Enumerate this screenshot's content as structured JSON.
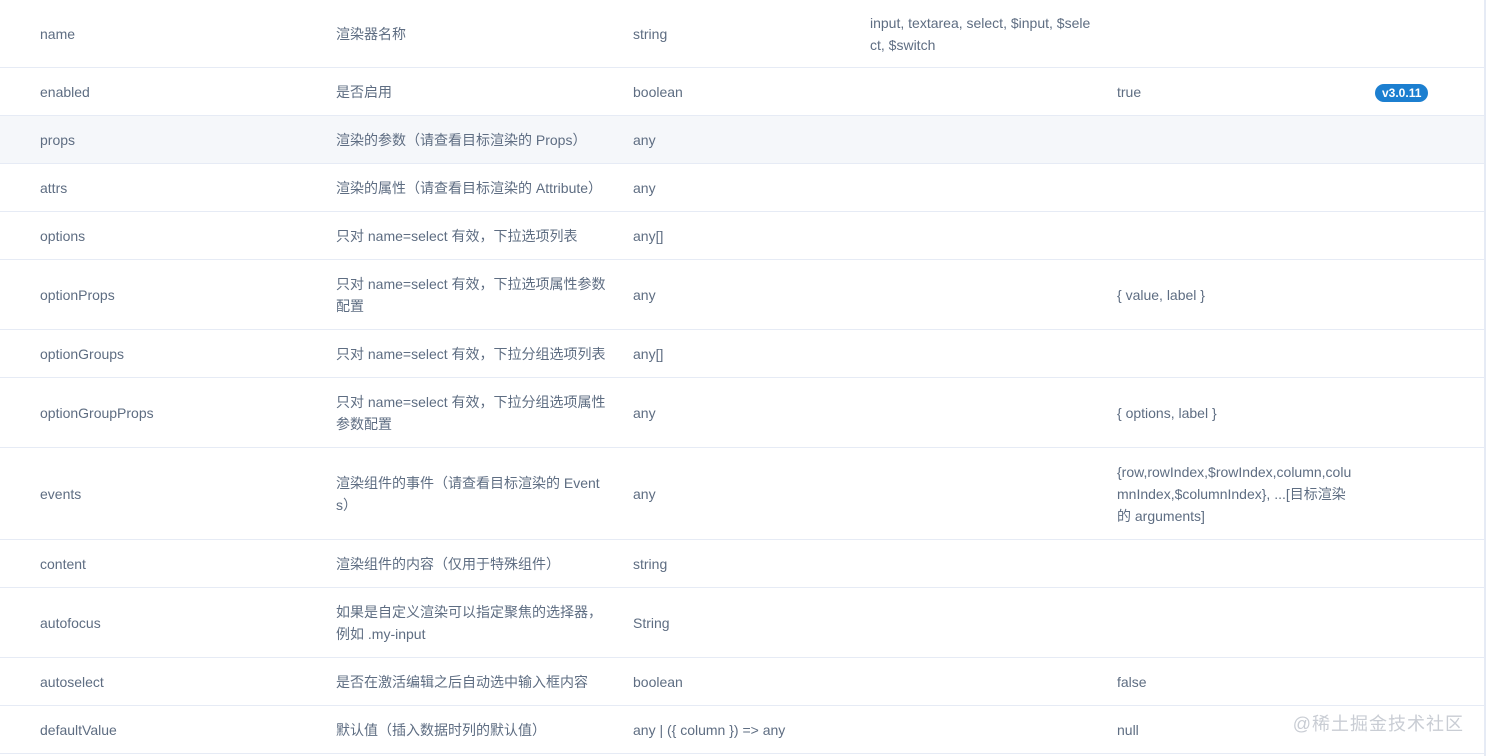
{
  "rows": [
    {
      "name": "name",
      "desc": "渲染器名称",
      "type": "string",
      "options": "input, textarea, select, $input, $select, $switch",
      "default": "",
      "version": ""
    },
    {
      "name": "enabled",
      "desc": "是否启用",
      "type": "boolean",
      "options": "",
      "default": "true",
      "version": "v3.0.11"
    },
    {
      "name": "props",
      "desc": "渲染的参数（请查看目标渲染的 Props）",
      "type": "any",
      "options": "",
      "default": "",
      "version": ""
    },
    {
      "name": "attrs",
      "desc": "渲染的属性（请查看目标渲染的 Attribute）",
      "type": "any",
      "options": "",
      "default": "",
      "version": ""
    },
    {
      "name": "options",
      "desc": "只对 name=select 有效，下拉选项列表",
      "type": "any[]",
      "options": "",
      "default": "",
      "version": ""
    },
    {
      "name": "optionProps",
      "desc": "只对 name=select 有效，下拉选项属性参数配置",
      "type": "any",
      "options": "",
      "default": "{ value, label }",
      "version": ""
    },
    {
      "name": "optionGroups",
      "desc": "只对 name=select 有效，下拉分组选项列表",
      "type": "any[]",
      "options": "",
      "default": "",
      "version": ""
    },
    {
      "name": "optionGroupProps",
      "desc": "只对 name=select 有效，下拉分组选项属性参数配置",
      "type": "any",
      "options": "",
      "default": "{ options, label }",
      "version": ""
    },
    {
      "name": "events",
      "desc": "渲染组件的事件（请查看目标渲染的 Events）",
      "type": "any",
      "options": "",
      "default": "{row,rowIndex,$rowIndex,column,columnIndex,$columnIndex}, ...[目标渲染的 arguments]",
      "version": ""
    },
    {
      "name": "content",
      "desc": "渲染组件的内容（仅用于特殊组件）",
      "type": "string",
      "options": "",
      "default": "",
      "version": ""
    },
    {
      "name": "autofocus",
      "desc": "如果是自定义渲染可以指定聚焦的选择器，例如 .my-input",
      "type": "String",
      "options": "",
      "default": "",
      "version": ""
    },
    {
      "name": "autoselect",
      "desc": "是否在激活编辑之后自动选中输入框内容",
      "type": "boolean",
      "options": "",
      "default": "false",
      "version": ""
    },
    {
      "name": "defaultValue",
      "desc": "默认值（插入数据时列的默认值）",
      "type": "any | ({ column }) => any",
      "options": "",
      "default": "null",
      "version": ""
    }
  ],
  "watermark": "@稀土掘金技术社区",
  "colors": {
    "badge": "#1c7fd0",
    "hover_row": "#f5f7fa",
    "border": "#e6ebf5"
  }
}
